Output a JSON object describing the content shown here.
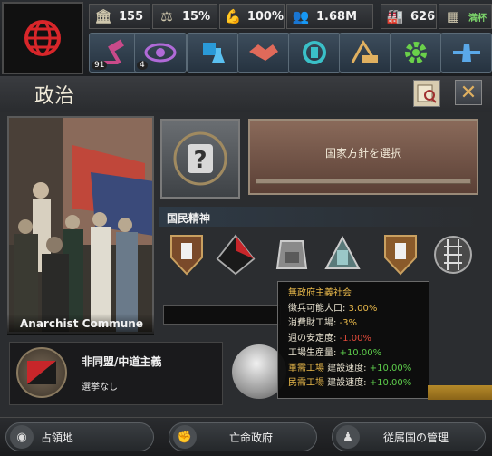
{
  "stats": {
    "factories": "155",
    "stability": "15%",
    "war_support": "100%",
    "manpower": "1.68M",
    "civilian_factories": "626",
    "extra": "満杯"
  },
  "menu_badges": {
    "decisions": "91",
    "intelligence": "4"
  },
  "panel": {
    "title": "政治"
  },
  "leader": {
    "name": "Anarchist Commune"
  },
  "national_focus": {
    "label": "国家方針を選択"
  },
  "national_spirits": {
    "label": "国民精神"
  },
  "ideology": {
    "name": "非同盟/中道主義",
    "election": "選挙なし"
  },
  "tooltip": {
    "title": "無政府主義社会",
    "line1_label": "徴兵可能人口: ",
    "line1_value": "3.00%",
    "line2_label": "消費財工場: ",
    "line2_value": "-3%",
    "line3_label": "週の安定度: ",
    "line3_value": "-1.00%",
    "line4_label": "工場生産量: ",
    "line4_value": "+10.00%",
    "line5_key": "軍需工場",
    "line5_label": " 建設速度: ",
    "line5_value": "+10.00%",
    "line6_key": "民需工場",
    "line6_label": " 建設速度: ",
    "line6_value": "+10.00%"
  },
  "bottom": {
    "occupied": "占領地",
    "exile": "亡命政府",
    "subjects": "従属国の管理"
  },
  "colors": {
    "tooltip_title": "#e8b84a",
    "positive": "#5ccb4a",
    "negative": "#e04a3a",
    "gold": "#e8b84a"
  }
}
